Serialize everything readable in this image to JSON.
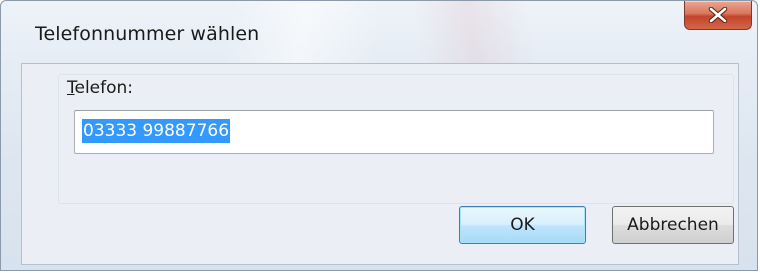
{
  "window": {
    "title": "Telefonnummer wählen"
  },
  "form": {
    "phone_label_accel": "T",
    "phone_label_rest": "elefon:",
    "phone_value": "03333 99887766"
  },
  "buttons": {
    "ok_label": "OK",
    "cancel_label": "Abbrechen"
  },
  "icons": {
    "close": "close-icon"
  },
  "colors": {
    "close_button": "#c9503a",
    "selection": "#3399ff",
    "default_button_border": "#3c7fb1"
  }
}
